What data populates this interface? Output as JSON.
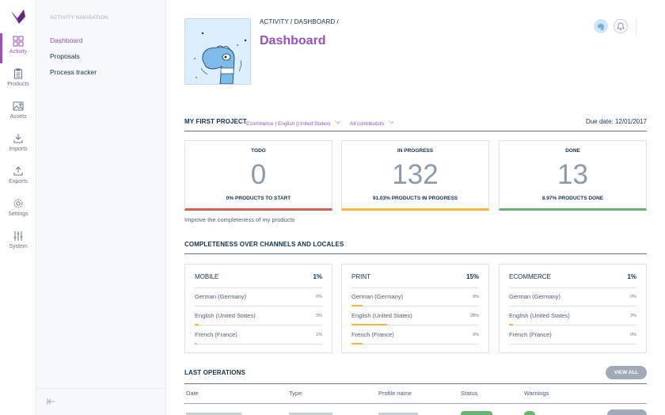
{
  "rail": {
    "items": [
      {
        "label": "Activity",
        "icon": "grid-icon",
        "active": true
      },
      {
        "label": "Products",
        "icon": "clipboard-icon"
      },
      {
        "label": "Assets",
        "icon": "image-icon"
      },
      {
        "label": "Imports",
        "icon": "import-icon"
      },
      {
        "label": "Exports",
        "icon": "export-icon"
      },
      {
        "label": "Settings",
        "icon": "gear-icon"
      },
      {
        "label": "System",
        "icon": "sliders-icon"
      }
    ]
  },
  "subnav": {
    "title": "ACTIVITY NAVIGATION",
    "items": [
      {
        "label": "Dashboard",
        "active": true
      },
      {
        "label": "Proposals"
      },
      {
        "label": "Process tracker"
      }
    ]
  },
  "header": {
    "breadcrumb": [
      "ACTIVITY",
      "DASHBOARD"
    ],
    "breadcrumb_sep": " / ",
    "title": "Dashboard"
  },
  "project": {
    "title": "MY FIRST PROJECT",
    "channel_locale": "Ecommerce | English (United States)",
    "contributors": "All contributors",
    "due_date": "Due date: 12/01/2017",
    "cards": [
      {
        "title": "TODO",
        "value": "0",
        "subtitle": "0% PRODUCTS TO START",
        "color": "#d4604f"
      },
      {
        "title": "IN PROGRESS",
        "value": "132",
        "subtitle": "91.03% PRODUCTS IN PROGRESS",
        "color": "#f9b53f"
      },
      {
        "title": "DONE",
        "value": "13",
        "subtitle": "8.97% PRODUCTS DONE",
        "color": "#67b373"
      }
    ],
    "improve_link": "Improve the completeness of my products"
  },
  "completeness": {
    "title": "COMPLETENESS OVER CHANNELS AND LOCALES",
    "channels": [
      {
        "name": "MOBILE",
        "percent": "1%",
        "locales": [
          {
            "name": "German (Germany)",
            "percent": "0%",
            "value": 0
          },
          {
            "name": "English (United States)",
            "percent": "3%",
            "value": 3
          },
          {
            "name": "French (France)",
            "percent": "1%",
            "value": 1
          }
        ]
      },
      {
        "name": "PRINT",
        "percent": "15%",
        "locales": [
          {
            "name": "German (Germany)",
            "percent": "9%",
            "value": 9
          },
          {
            "name": "English (United States)",
            "percent": "28%",
            "value": 28
          },
          {
            "name": "French (France)",
            "percent": "9%",
            "value": 9
          }
        ]
      },
      {
        "name": "ECOMMERCE",
        "percent": "1%",
        "locales": [
          {
            "name": "German (Germany)",
            "percent": "0%",
            "value": 0
          },
          {
            "name": "English (United States)",
            "percent": "3%",
            "value": 3
          },
          {
            "name": "French (France)",
            "percent": "0%",
            "value": 0
          }
        ]
      }
    ]
  },
  "operations": {
    "title": "LAST OPERATIONS",
    "view_all": "VIEW ALL",
    "columns": [
      "Date",
      "Type",
      "Profile name",
      "Status",
      "Warnings"
    ]
  },
  "colors": {
    "accent": "#9452ba",
    "text": "#11324d",
    "todo": "#d4604f",
    "in_progress": "#f9b53f",
    "done": "#67b373"
  }
}
